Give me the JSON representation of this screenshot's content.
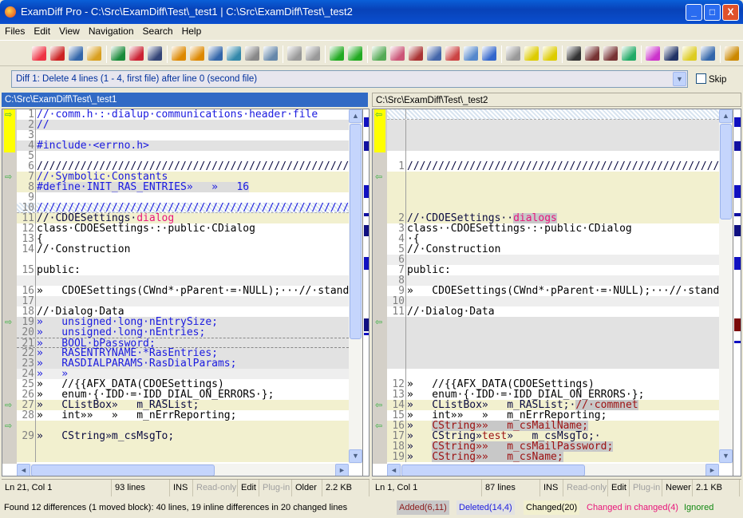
{
  "window": {
    "title": "ExamDiff Pro - C:\\Src\\ExamDiff\\Test\\_test1  |  C:\\Src\\ExamDiff\\Test\\_test2",
    "minimize": "_",
    "maximize": "□",
    "close": "X"
  },
  "menu": [
    "Files",
    "Edit",
    "View",
    "Navigation",
    "Search",
    "Help"
  ],
  "toolbar": {
    "icons": [
      "new-comparison-icon",
      "cherries-icon",
      "swap-files-icon",
      "open-folder-icon",
      "save-first-icon",
      "save-second-icon",
      "save-both-icon",
      "edit-first-icon",
      "edit-second-icon",
      "save-report-icon",
      "merge-icon",
      "print-icon",
      "print-preview-icon",
      "undo-icon",
      "redo-icon",
      "copy-right-icon",
      "copy-left-icon",
      "show-first-icon",
      "show-second-icon",
      "split-view-icon",
      "horizontal-view-icon",
      "show-diffs-icon",
      "filter-icon",
      "options-view-icon",
      "previous-diff-icon",
      "current-diff-icon",
      "next-diff-icon",
      "find-icon",
      "find-next-icon",
      "find-previous-icon",
      "refresh-icon",
      "color-scheme-icon",
      "word-wrap-icon",
      "highlight-icon",
      "edit-mode-icon",
      "settings-icon"
    ]
  },
  "diffbar": {
    "value": "Diff 1: Delete 4 lines (1 - 4, first file) after line 0 (second file)",
    "skip_label": "Skip"
  },
  "left": {
    "path": "C:\\Src\\ExamDiff\\Test\\_test1",
    "rows": [
      {
        "n": "1",
        "c": "white",
        "s": [
          [
            "//·comm.h·:·dialup·communications·header·file",
            "blue"
          ]
        ]
      },
      {
        "n": "2",
        "c": "gray",
        "s": [
          [
            "//",
            "blue"
          ]
        ]
      },
      {
        "n": "3",
        "c": "white",
        "s": []
      },
      {
        "n": "4",
        "c": "gray",
        "s": [
          [
            "#include·<errno.h>",
            "blue"
          ]
        ]
      },
      {
        "n": "5",
        "c": "white",
        "s": []
      },
      {
        "n": "6",
        "c": "white",
        "s": [
          [
            "/////////////////////////////////////////////////////////",
            "navy"
          ]
        ]
      },
      {
        "n": "7",
        "c": "yellow",
        "s": [
          [
            "//·Symbolic·Constants",
            "blue"
          ]
        ]
      },
      {
        "n": "8",
        "c": "yellow",
        "s": [
          [
            "#define·INIT_RAS_ENTRIES»   »   16",
            "blue hlpart"
          ]
        ]
      },
      {
        "n": "9",
        "c": "white",
        "s": []
      },
      {
        "n": "10",
        "c": "hatch",
        "s": [
          [
            "/////////////////////////////////////////////////////////",
            "blue"
          ]
        ]
      },
      {
        "n": "11",
        "c": "yellow",
        "s": [
          [
            "//·CDOESettings·",
            "navy"
          ],
          [
            "dialog",
            "pink"
          ]
        ]
      },
      {
        "n": "12",
        "c": "white",
        "s": [
          [
            "class·CDOESettings·:·public·CDialog",
            ""
          ]
        ]
      },
      {
        "n": "13",
        "c": "white",
        "s": [
          [
            "{",
            ""
          ]
        ]
      },
      {
        "n": "14",
        "c": "white",
        "s": [
          [
            "//·Construction",
            ""
          ]
        ]
      },
      {
        "n": "",
        "c": "white",
        "s": []
      },
      {
        "n": "15",
        "c": "white",
        "s": [
          [
            "public:",
            ""
          ]
        ]
      },
      {
        "n": "",
        "c": "lgray",
        "s": []
      },
      {
        "n": "16",
        "c": "white",
        "s": [
          [
            "»   CDOESettings(CWnd*·pParent·=·NULL);···//·standard",
            ""
          ]
        ]
      },
      {
        "n": "17",
        "c": "lgray",
        "s": []
      },
      {
        "n": "18",
        "c": "white",
        "s": [
          [
            "//·Dialog·Data",
            ""
          ]
        ]
      },
      {
        "n": "19",
        "c": "gray",
        "s": [
          [
            "»   unsigned·long·nEntrySize;",
            "blue"
          ]
        ]
      },
      {
        "n": "20",
        "c": "gray",
        "s": [
          [
            "»   unsigned·long·nEntries;",
            "blue"
          ]
        ]
      },
      {
        "n": "21",
        "c": "gray dashed",
        "s": [
          [
            "»   BOOL·bPassword;",
            "blue"
          ]
        ]
      },
      {
        "n": "22",
        "c": "gray",
        "s": [
          [
            "»   RASENTRYNAME·*RasEntries;",
            "blue"
          ]
        ]
      },
      {
        "n": "23",
        "c": "gray",
        "s": [
          [
            "»   RASDIALPARAMS·RasDialParams;",
            "blue"
          ]
        ]
      },
      {
        "n": "24",
        "c": "lgray",
        "s": [
          [
            "»   »",
            "blue"
          ]
        ]
      },
      {
        "n": "25",
        "c": "white",
        "s": [
          [
            "»   //{{AFX_DATA(CDOESettings)",
            ""
          ]
        ]
      },
      {
        "n": "26",
        "c": "white",
        "s": [
          [
            "»   enum·{·IDD·=·IDD_DIAL_ON_ERRORS·};",
            ""
          ]
        ]
      },
      {
        "n": "27",
        "c": "yellow",
        "s": [
          [
            "»   CListBox»   m_RASList;",
            "navy"
          ]
        ]
      },
      {
        "n": "28",
        "c": "white",
        "s": [
          [
            "»   int»»   »   m_nErrReporting;",
            ""
          ]
        ]
      },
      {
        "n": "",
        "c": "yellow",
        "s": []
      },
      {
        "n": "29",
        "c": "yellow",
        "s": [
          [
            "»   CString»m_csMsgTo;",
            "navy"
          ]
        ]
      },
      {
        "n": "",
        "c": "yellow",
        "s": []
      },
      {
        "n": "",
        "c": "yellow",
        "s": []
      }
    ],
    "status": {
      "pos": "Ln 21, Col 1",
      "lines": "93 lines",
      "ins": "INS",
      "readonly": "Read-only",
      "edit": "Edit",
      "plugin": "Plug-in",
      "age": "Older",
      "size": "2.2 KB"
    }
  },
  "right": {
    "path": "C:\\Src\\ExamDiff\\Test\\_test2",
    "rows": [
      {
        "n": "",
        "c": "hatch",
        "s": []
      },
      {
        "n": "",
        "c": "gray",
        "s": []
      },
      {
        "n": "",
        "c": "gray",
        "s": []
      },
      {
        "n": "",
        "c": "gray",
        "s": []
      },
      {
        "n": "",
        "c": "white",
        "s": []
      },
      {
        "n": "1",
        "c": "white",
        "s": [
          [
            "/////////////////////////////////////////////////////////",
            "navy"
          ]
        ]
      },
      {
        "n": "",
        "c": "yellow",
        "s": []
      },
      {
        "n": "",
        "c": "yellow",
        "s": []
      },
      {
        "n": "",
        "c": "yellow",
        "s": []
      },
      {
        "n": "",
        "c": "yellow",
        "s": []
      },
      {
        "n": "2",
        "c": "yellow",
        "s": [
          [
            "//·CDOESettings··",
            "navy"
          ],
          [
            "dialogs",
            "pink hl"
          ]
        ]
      },
      {
        "n": "3",
        "c": "white",
        "s": [
          [
            "class··CDOESettings·:·public·CDialog",
            ""
          ]
        ]
      },
      {
        "n": "4",
        "c": "white",
        "s": [
          [
            "·{",
            ""
          ]
        ]
      },
      {
        "n": "5",
        "c": "white",
        "s": [
          [
            "//·Construction",
            ""
          ]
        ]
      },
      {
        "n": "6",
        "c": "lgray",
        "s": []
      },
      {
        "n": "7",
        "c": "white",
        "s": [
          [
            "public:",
            ""
          ]
        ]
      },
      {
        "n": "8",
        "c": "lgray",
        "s": []
      },
      {
        "n": "9",
        "c": "white",
        "s": [
          [
            "»   CDOESettings(CWnd*·pParent·=·NULL);···//·standard",
            ""
          ]
        ]
      },
      {
        "n": "10",
        "c": "lgray",
        "s": []
      },
      {
        "n": "11",
        "c": "white",
        "s": [
          [
            "//·Dialog·Data",
            ""
          ]
        ]
      },
      {
        "n": "",
        "c": "gray",
        "s": []
      },
      {
        "n": "",
        "c": "gray",
        "s": []
      },
      {
        "n": "",
        "c": "gray",
        "s": []
      },
      {
        "n": "",
        "c": "gray",
        "s": []
      },
      {
        "n": "",
        "c": "gray",
        "s": []
      },
      {
        "n": "",
        "c": "white",
        "s": []
      },
      {
        "n": "12",
        "c": "white",
        "s": [
          [
            "»   //{{AFX_DATA(CDOESettings)",
            ""
          ]
        ]
      },
      {
        "n": "13",
        "c": "white",
        "s": [
          [
            "»   enum·{·IDD·=·IDD_DIAL_ON_ERRORS·};",
            ""
          ]
        ]
      },
      {
        "n": "14",
        "c": "yellow",
        "s": [
          [
            "»   CListBox»   m_RASList;·",
            "navy"
          ],
          [
            "//·commnet",
            "red hl"
          ]
        ]
      },
      {
        "n": "15",
        "c": "white",
        "s": [
          [
            "»   int»»   »   m_nErrReporting;",
            ""
          ]
        ]
      },
      {
        "n": "16",
        "c": "yellow",
        "s": [
          [
            "»   ",
            "navy"
          ],
          [
            "CString»»   m_csMailName;",
            "red hl"
          ]
        ]
      },
      {
        "n": "17",
        "c": "yellow",
        "s": [
          [
            "»   CString»",
            "navy"
          ],
          [
            "test",
            "red"
          ],
          [
            "»   m_csMsgTo;·",
            "navy"
          ]
        ]
      },
      {
        "n": "18",
        "c": "yellow",
        "s": [
          [
            "»   ",
            "navy"
          ],
          [
            "CString»»   m_csMailPassword;",
            "red hl"
          ]
        ]
      },
      {
        "n": "19",
        "c": "yellow",
        "s": [
          [
            "»   ",
            "navy"
          ],
          [
            "CString»»   m_csName;",
            "red hl"
          ]
        ]
      }
    ],
    "status": {
      "pos": "Ln 1, Col 1",
      "lines": "87 lines",
      "ins": "INS",
      "readonly": "Read-only",
      "edit": "Edit",
      "plugin": "Plug-in",
      "age": "Newer",
      "size": "2.1 KB"
    }
  },
  "summary": "Found 12 differences (1 moved block): 40 lines, 19 inline differences in 20 changed lines",
  "legend": [
    {
      "label": "Added(6,11)",
      "color": "#8b1a1a",
      "bg": "#c8c8c8"
    },
    {
      "label": "Deleted(14,4)",
      "color": "#1a1adf",
      "bg": "#e2e2e2"
    },
    {
      "label": "Changed(20)",
      "color": "#000000",
      "bg": "#f2f0cf"
    },
    {
      "label": "Changed in changed(4)",
      "color": "#e8157a",
      "bg": "#ece9d8"
    },
    {
      "label": "Ignored",
      "color": "#118811",
      "bg": "#ece9d8"
    }
  ]
}
